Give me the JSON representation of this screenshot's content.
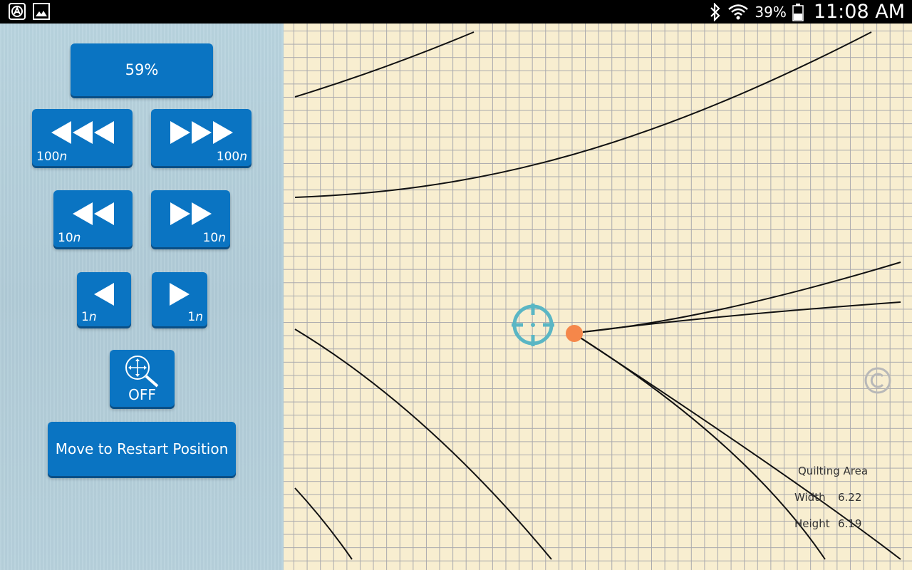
{
  "status_bar": {
    "battery_percent": "39%",
    "time": "11:08 AM",
    "icons": [
      "app-notification-icon",
      "image-notification-icon",
      "bluetooth-icon",
      "wifi-icon",
      "battery-icon"
    ]
  },
  "controls": {
    "speed_label": "59%",
    "rewind_100_label": "100",
    "forward_100_label": "100",
    "rewind_10_label": "10",
    "forward_10_label": "10",
    "rewind_1_label": "1",
    "forward_1_label": "1",
    "unit_suffix": "n",
    "zoom_state": "OFF",
    "restart_label": "Move to Restart Position"
  },
  "quilting_area": {
    "title": "Quilting Area",
    "width_label": "Width",
    "width_value": "6.22",
    "height_label": "Height",
    "height_value": "6.19"
  },
  "colors": {
    "button_blue": "#0a74c2",
    "grid_paper": "#f8eed0",
    "crosshair": "#5ab6c4",
    "needle_dot": "#f5874a"
  }
}
